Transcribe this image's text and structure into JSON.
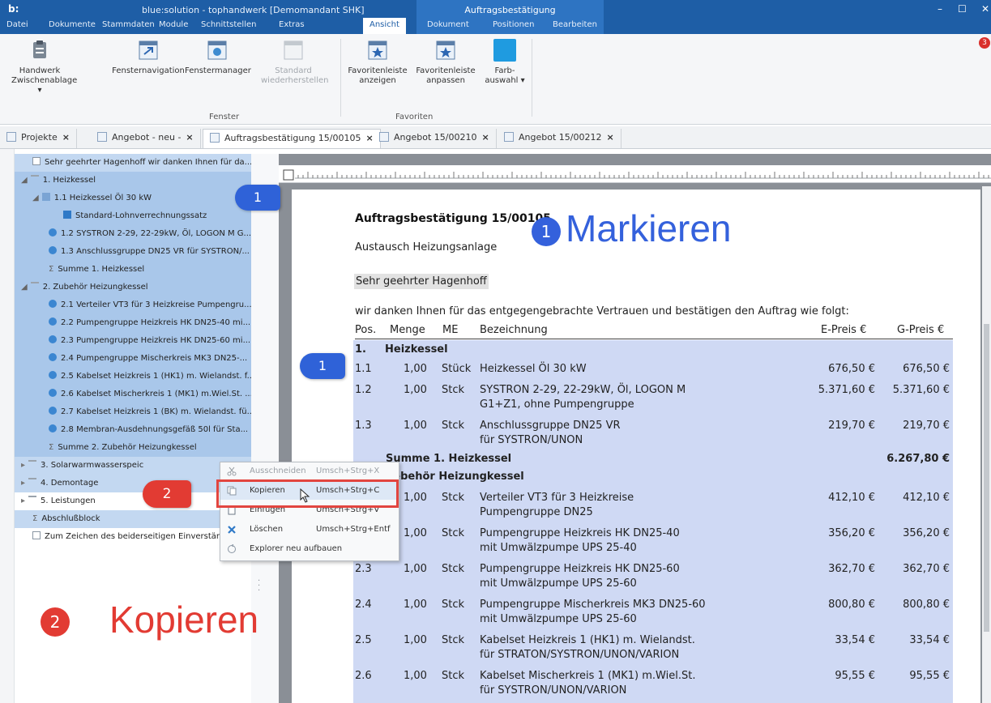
{
  "titlebar": {
    "logo": "b:",
    "app_title": "blue:solution - tophandwerk [Demomandant SHK]",
    "context_group": "Auftragsbestätigung",
    "minimize": "–",
    "maximize": "☐",
    "close": "✕"
  },
  "menu": {
    "datei": "Datei",
    "dokumente": "Dokumente",
    "stammdaten": "Stammdaten",
    "module": "Module",
    "schnittstellen": "Schnittstellen",
    "extras": "Extras",
    "ansicht": "Ansicht",
    "dokument": "Dokument",
    "positionen": "Positionen",
    "bearbeiten": "Bearbeiten"
  },
  "notification_count": "3",
  "ribbon": {
    "handwerk_1": "Handwerk",
    "handwerk_2": "Zwischenablage ▾",
    "fensternavigation": "Fensternavigation",
    "fenstermanager": "Fenstermanager",
    "standard_1": "Standard",
    "standard_2": "wiederherstellen",
    "fav_anzeigen_1": "Favoritenleiste",
    "fav_anzeigen_2": "anzeigen",
    "fav_anpassen_1": "Favoritenleiste",
    "fav_anpassen_2": "anpassen",
    "farb_1": "Farb-",
    "farb_2": "auswahl ▾",
    "group_fenster": "Fenster",
    "group_favoriten": "Favoriten"
  },
  "tabs": {
    "projekte": "Projekte",
    "angebot_neu": "Angebot - neu -",
    "auftrag": "Auftragsbestätigung 15/00105",
    "angebot_210": "Angebot 15/00210",
    "angebot_212": "Angebot 15/00212",
    "close": "×"
  },
  "tree": [
    "Sehr geehrter Hagenhoff wir danken Ihnen für da...",
    "1. Heizkessel",
    "1.1 Heizkessel Öl 30 kW",
    "Standard-Lohnverrechnungssatz",
    "1.2 SYSTRON 2-29, 22-29kW, Öl, LOGON M G...",
    "1.3 Anschlussgruppe DN25 VR für SYSTRON/...",
    "Summe 1. Heizkessel",
    "2. Zubehör Heizungkessel",
    "2.1 Verteiler VT3 für 3 Heizkreise Pumpengru...",
    "2.2 Pumpengruppe Heizkreis HK DN25-40 mi...",
    "2.3 Pumpengruppe Heizkreis HK DN25-60 mi...",
    "2.4 Pumpengruppe Mischerkreis MK3 DN25-...",
    "2.5 Kabelset Heizkreis 1 (HK1) m. Wielandst. f...",
    "2.6 Kabelset Mischerkreis 1 (MK1) m.Wiel.St. ...",
    "2.7 Kabelset Heizkreis 1 (BK) m. Wielandst. fü...",
    "2.8 Membran-Ausdehnungsgefäß 50l für Sta...",
    "Summe 2. Zubehör Heizungkessel",
    "3. Solarwarmwasserspeic",
    "4. Demontage",
    "5. Leistungen",
    "Abschlußblock",
    "Zum Zeichen des beiderseitigen Einverständ"
  ],
  "context_menu": {
    "ausschneiden": "Ausschneiden",
    "ausschneiden_sc": "Umsch+Strg+X",
    "kopieren": "Kopieren",
    "kopieren_sc": "Umsch+Strg+C",
    "einfuegen": "Einfügen",
    "einfuegen_sc": "Umsch+Strg+V",
    "loeschen": "Löschen",
    "loeschen_sc": "Umsch+Strg+Entf",
    "explorer": "Explorer neu aufbauen"
  },
  "document": {
    "heading": "Auftragsbestätigung 15/00105",
    "subject": "Austausch Heizungsanlage",
    "greeting": "Sehr geehrter Hagenhoff",
    "intro": "wir danken Ihnen für das entgegengebrachte Vertrauen und bestätigen den Auftrag wie folgt:",
    "col_pos": "Pos.",
    "col_menge": "Menge",
    "col_me": "ME",
    "col_bez": "Bezeichnung",
    "col_epreis": "E-Preis €",
    "col_gpreis": "G-Preis €",
    "sec1_pos": "1.",
    "sec1_title": "Heizkessel",
    "sum1_label": "Summe 1. Heizkessel",
    "sum1_value": "6.267,80 €",
    "sec2_title": "bebehör Heizungkessel",
    "rows": [
      {
        "pos": "1.1",
        "menge": "1,00",
        "me": "Stück",
        "bez1": "Heizkessel Öl 30 kW",
        "bez2": "",
        "e": "676,50 €",
        "g": "676,50 €"
      },
      {
        "pos": "1.2",
        "menge": "1,00",
        "me": "Stck",
        "bez1": "SYSTRON 2-29, 22-29kW, Öl, LOGON M",
        "bez2": "G1+Z1, ohne Pumpengruppe",
        "e": "5.371,60 €",
        "g": "5.371,60 €"
      },
      {
        "pos": "1.3",
        "menge": "1,00",
        "me": "Stck",
        "bez1": "Anschlussgruppe DN25 VR",
        "bez2": "für SYSTRON/UNON",
        "e": "219,70 €",
        "g": "219,70 €"
      },
      {
        "pos": "",
        "menge": "1,00",
        "me": "Stck",
        "bez1": "Verteiler VT3 für 3 Heizkreise",
        "bez2": "Pumpengruppe DN25",
        "e": "412,10 €",
        "g": "412,10 €"
      },
      {
        "pos": "",
        "menge": "1,00",
        "me": "Stck",
        "bez1": "Pumpengruppe Heizkreis HK DN25-40",
        "bez2": "mit Umwälzpumpe UPS 25-40",
        "e": "356,20 €",
        "g": "356,20 €"
      },
      {
        "pos": "2.3",
        "menge": "1,00",
        "me": "Stck",
        "bez1": "Pumpengruppe Heizkreis HK DN25-60",
        "bez2": "mit Umwälzpumpe UPS 25-60",
        "e": "362,70 €",
        "g": "362,70 €"
      },
      {
        "pos": "2.4",
        "menge": "1,00",
        "me": "Stck",
        "bez1": "Pumpengruppe Mischerkreis MK3 DN25-60",
        "bez2": "mit Umwälzpumpe UPS 25-60",
        "e": "800,80 €",
        "g": "800,80 €"
      },
      {
        "pos": "2.5",
        "menge": "1,00",
        "me": "Stck",
        "bez1": "Kabelset Heizkreis 1 (HK1) m. Wielandst.",
        "bez2": "für STRATON/SYSTRON/UNON/VARION",
        "e": "33,54 €",
        "g": "33,54 €"
      },
      {
        "pos": "2.6",
        "menge": "1,00",
        "me": "Stck",
        "bez1": "Kabelset Mischerkreis 1 (MK1) m.Wiel.St.",
        "bez2": "für SYSTRON/UNON/VARION",
        "e": "95,55 €",
        "g": "95,55 €"
      }
    ]
  },
  "annotations": {
    "badge_1a": "1",
    "badge_1b": "1",
    "badge_2": "2",
    "step1_num": "1",
    "step1_text": "Markieren",
    "step2_num": "2",
    "step2_text": "Kopieren"
  }
}
